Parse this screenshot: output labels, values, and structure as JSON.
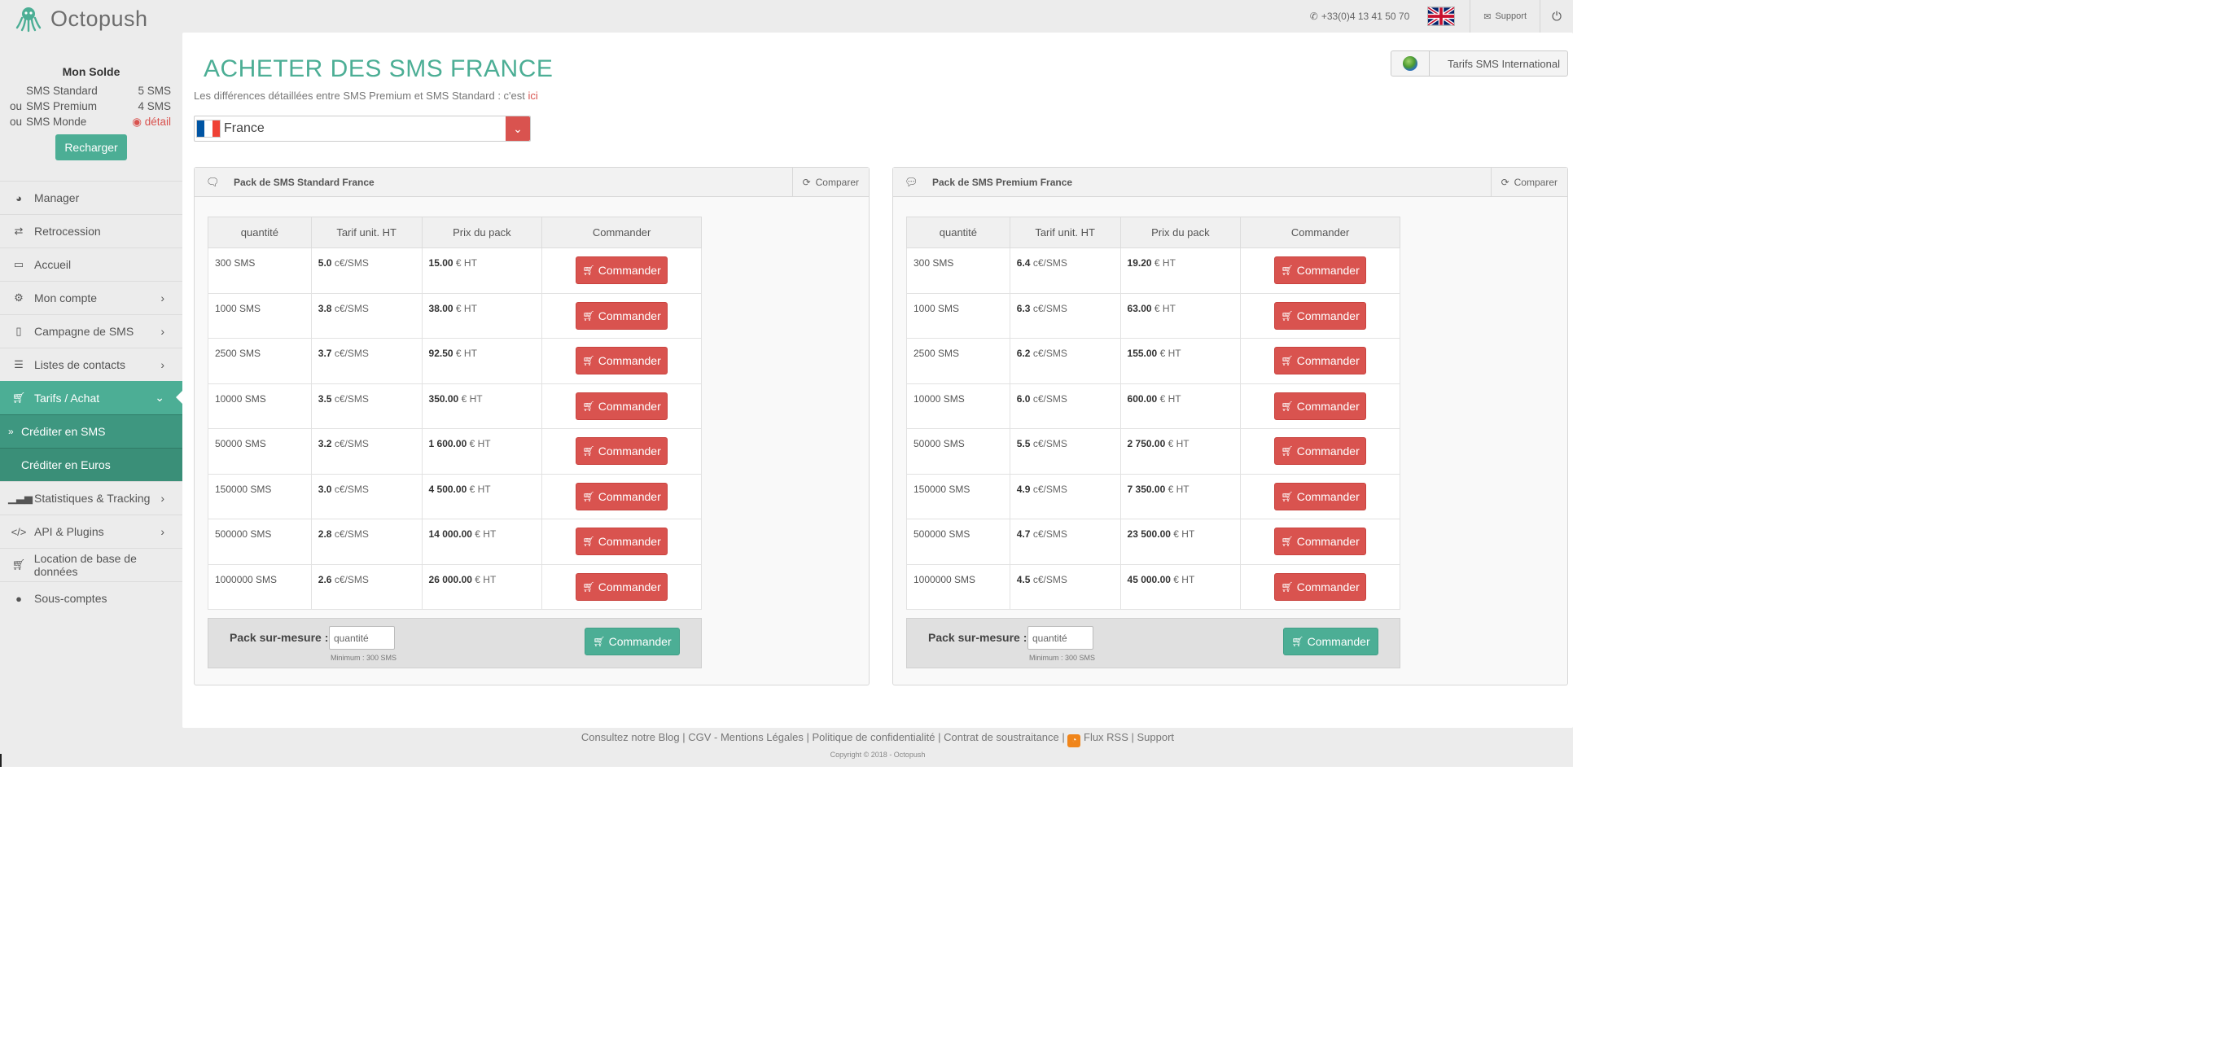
{
  "app": {
    "logo_text": "Octopush",
    "phone": "+33(0)4 13 41 50 70",
    "support": "Support",
    "language_flag": "uk-flag",
    "brand_color": "#4cae95",
    "danger_color": "#d9534f"
  },
  "sidebar": {
    "solde_title": "Mon Solde",
    "solde_rows": [
      {
        "prefix": "",
        "label": "SMS Standard",
        "value": "5 SMS"
      },
      {
        "prefix": "ou",
        "label": "SMS Premium",
        "value": "4 SMS"
      },
      {
        "prefix": "ou",
        "label": "SMS Monde",
        "value": "détail"
      }
    ],
    "recharge_label": "Recharger",
    "menu": [
      {
        "label": "Manager",
        "icon": "dashboard-icon"
      },
      {
        "label": "Retrocession",
        "icon": "exchange-icon"
      },
      {
        "label": "Accueil",
        "icon": "desktop-icon"
      },
      {
        "label": "Mon compte",
        "icon": "gear-icon"
      },
      {
        "label": "Campagne de SMS",
        "icon": "mobile-icon"
      },
      {
        "label": "Listes de contacts",
        "icon": "list-icon"
      },
      {
        "label": "Tarifs / Achat",
        "icon": "cart-icon"
      },
      {
        "label": "Statistiques & Tracking",
        "icon": "bar-chart-icon"
      },
      {
        "label": "API & Plugins",
        "icon": "code-icon"
      },
      {
        "label": "Location de base de données",
        "icon": "cart-icon"
      },
      {
        "label": "Sous-comptes",
        "icon": "user-icon"
      }
    ],
    "submenu": [
      {
        "label": "Créditer en SMS"
      },
      {
        "label": "Créditer en Euros"
      }
    ]
  },
  "page": {
    "title": "ACHETER DES SMS FRANCE",
    "subtitle_text": "Les différences détaillées entre SMS Premium et SMS Standard : c'est",
    "subtitle_link": "ici",
    "intl_button": "Tarifs SMS International",
    "country": "France"
  },
  "panels": [
    {
      "title": "Pack de SMS Standard France",
      "compare": "Comparer",
      "headers": [
        "quantité",
        "Tarif unit. HT",
        "Prix du pack",
        "Commander"
      ],
      "rows": [
        {
          "qty": "300 SMS",
          "rate": "5.0",
          "rate_unit": "c€/SMS",
          "price": "15.00",
          "price_unit": "€ HT",
          "cmd": "Commander"
        },
        {
          "qty": "1000 SMS",
          "rate": "3.8",
          "rate_unit": "c€/SMS",
          "price": "38.00",
          "price_unit": "€ HT",
          "cmd": "Commander"
        },
        {
          "qty": "2500 SMS",
          "rate": "3.7",
          "rate_unit": "c€/SMS",
          "price": "92.50",
          "price_unit": "€ HT",
          "cmd": "Commander"
        },
        {
          "qty": "10000 SMS",
          "rate": "3.5",
          "rate_unit": "c€/SMS",
          "price": "350.00",
          "price_unit": "€ HT",
          "cmd": "Commander"
        },
        {
          "qty": "50000 SMS",
          "rate": "3.2",
          "rate_unit": "c€/SMS",
          "price": "1 600.00",
          "price_unit": "€ HT",
          "cmd": "Commander"
        },
        {
          "qty": "150000 SMS",
          "rate": "3.0",
          "rate_unit": "c€/SMS",
          "price": "4 500.00",
          "price_unit": "€ HT",
          "cmd": "Commander"
        },
        {
          "qty": "500000 SMS",
          "rate": "2.8",
          "rate_unit": "c€/SMS",
          "price": "14 000.00",
          "price_unit": "€ HT",
          "cmd": "Commander"
        },
        {
          "qty": "1000000 SMS",
          "rate": "2.6",
          "rate_unit": "c€/SMS",
          "price": "26 000.00",
          "price_unit": "€ HT",
          "cmd": "Commander"
        }
      ],
      "custom_label": "Pack sur-mesure :",
      "custom_placeholder": "quantité",
      "custom_min": "Minimum : 300 SMS",
      "custom_cmd": "Commander"
    },
    {
      "title": "Pack de SMS Premium France",
      "compare": "Comparer",
      "headers": [
        "quantité",
        "Tarif unit. HT",
        "Prix du pack",
        "Commander"
      ],
      "rows": [
        {
          "qty": "300 SMS",
          "rate": "6.4",
          "rate_unit": "c€/SMS",
          "price": "19.20",
          "price_unit": "€ HT",
          "cmd": "Commander"
        },
        {
          "qty": "1000 SMS",
          "rate": "6.3",
          "rate_unit": "c€/SMS",
          "price": "63.00",
          "price_unit": "€ HT",
          "cmd": "Commander"
        },
        {
          "qty": "2500 SMS",
          "rate": "6.2",
          "rate_unit": "c€/SMS",
          "price": "155.00",
          "price_unit": "€ HT",
          "cmd": "Commander"
        },
        {
          "qty": "10000 SMS",
          "rate": "6.0",
          "rate_unit": "c€/SMS",
          "price": "600.00",
          "price_unit": "€ HT",
          "cmd": "Commander"
        },
        {
          "qty": "50000 SMS",
          "rate": "5.5",
          "rate_unit": "c€/SMS",
          "price": "2 750.00",
          "price_unit": "€ HT",
          "cmd": "Commander"
        },
        {
          "qty": "150000 SMS",
          "rate": "4.9",
          "rate_unit": "c€/SMS",
          "price": "7 350.00",
          "price_unit": "€ HT",
          "cmd": "Commander"
        },
        {
          "qty": "500000 SMS",
          "rate": "4.7",
          "rate_unit": "c€/SMS",
          "price": "23 500.00",
          "price_unit": "€ HT",
          "cmd": "Commander"
        },
        {
          "qty": "1000000 SMS",
          "rate": "4.5",
          "rate_unit": "c€/SMS",
          "price": "45 000.00",
          "price_unit": "€ HT",
          "cmd": "Commander"
        }
      ],
      "custom_label": "Pack sur-mesure :",
      "custom_placeholder": "quantité",
      "custom_min": "Minimum : 300 SMS",
      "custom_cmd": "Commander"
    }
  ],
  "footer": {
    "links": [
      "Consultez notre Blog",
      "CGV - Mentions Légales",
      "Politique de confidentialité",
      "Contrat de soustraitance",
      "Flux RSS",
      "Support"
    ],
    "copyright": "Copyright © 2018 - Octopush"
  }
}
